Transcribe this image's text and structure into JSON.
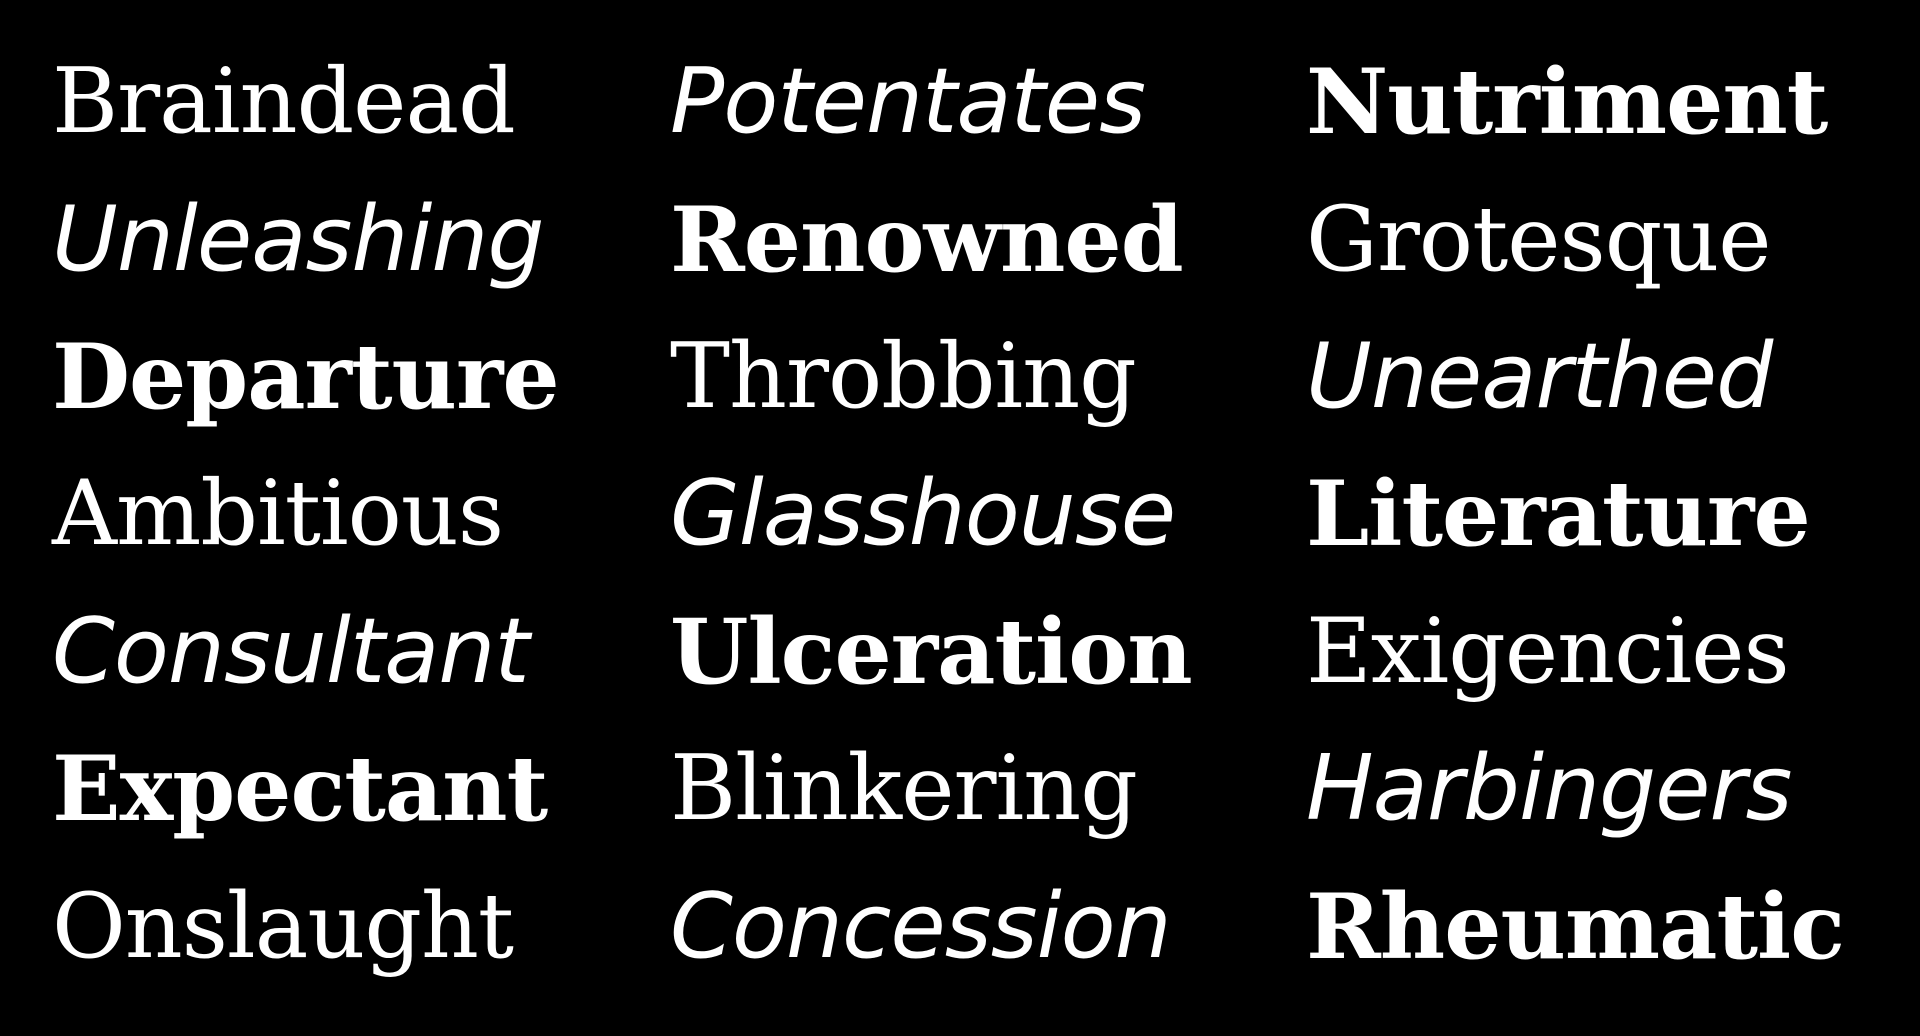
{
  "words": {
    "row1": [
      "Braindead",
      "Potentates",
      "Nutriment"
    ],
    "row2": [
      "Unleashing",
      "Renowned",
      "Grotesque"
    ],
    "row3": [
      "Departure",
      "Throbbing",
      "Unearthed"
    ],
    "row4": [
      "Ambitious",
      "Glasshouse",
      "Literature"
    ],
    "row5": [
      "Consultant",
      "Ulceration",
      "Exigencies"
    ],
    "row6": [
      "Expectant",
      "Blinkering",
      "Harbingers"
    ],
    "row7": [
      "Onslaught",
      "Concession",
      "Rheumatic"
    ]
  },
  "colors": {
    "background": "#000000",
    "text": "#ffffff"
  }
}
